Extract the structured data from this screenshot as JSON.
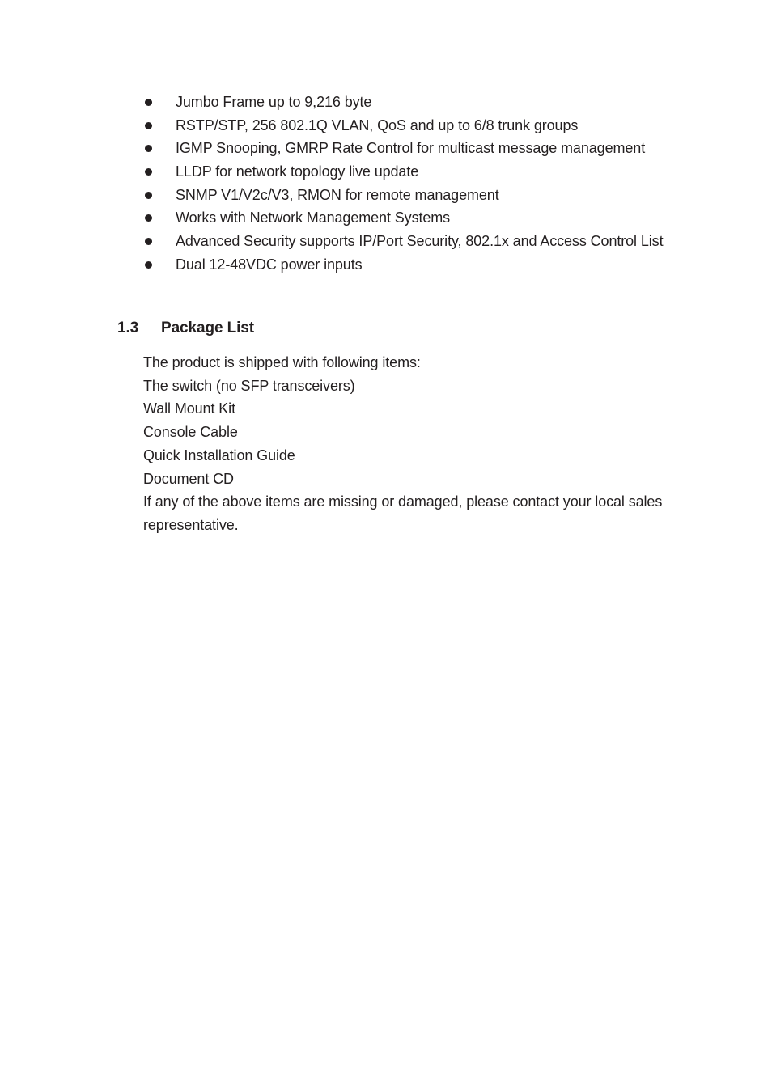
{
  "document": {
    "background_color": "#ffffff",
    "text_color": "#231f20"
  },
  "features": {
    "bullet_glyph": "filled-round-bullet",
    "items": [
      {
        "text": "Jumbo Frame up to 9,216 byte"
      },
      {
        "text": "RSTP/STP, 256 802.1Q VLAN, QoS and up to 6/8 trunk groups"
      },
      {
        "text": "IGMP Snooping, GMRP Rate Control for multicast message management"
      },
      {
        "text": "LLDP for network topology live update"
      },
      {
        "text": "SNMP V1/V2c/V3, RMON for remote management"
      },
      {
        "text": "Works with Network Management Systems"
      },
      {
        "text": "Advanced Security supports IP/Port Security, 802.1x and Access Control List"
      },
      {
        "text": "Dual 12-48VDC power inputs"
      }
    ]
  },
  "section": {
    "number": "1.3",
    "title": "Package List"
  },
  "package_list": {
    "intro": "The product is shipped with following items:",
    "items": [
      "The switch (no SFP transceivers)",
      "Wall Mount Kit",
      "Console Cable",
      "Quick Installation Guide",
      "Document CD"
    ],
    "note": "If any of the above items are missing or damaged, please contact your local sales representative."
  }
}
